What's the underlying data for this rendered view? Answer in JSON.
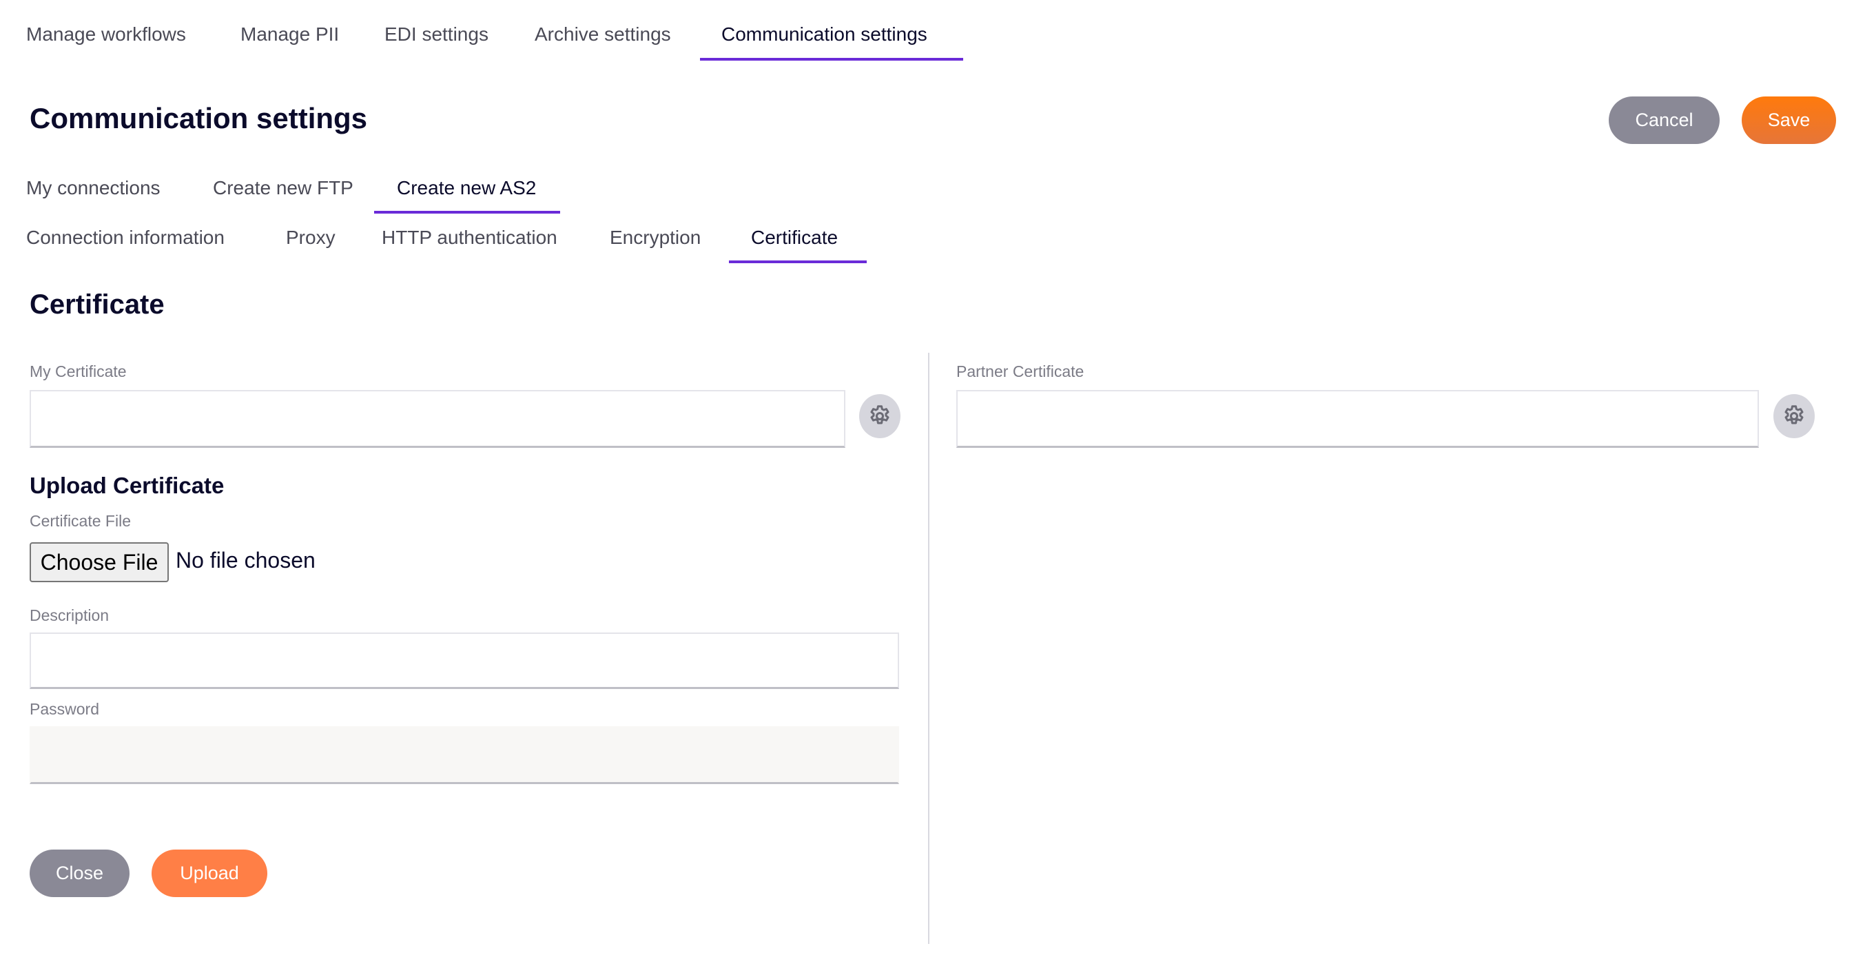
{
  "top_tabs": [
    {
      "label": "Manage workflows",
      "active": false
    },
    {
      "label": "Manage PII",
      "active": false
    },
    {
      "label": "EDI settings",
      "active": false
    },
    {
      "label": "Archive settings",
      "active": false
    },
    {
      "label": "Communication settings",
      "active": true
    }
  ],
  "page": {
    "title": "Communication settings",
    "cancel_label": "Cancel",
    "save_label": "Save"
  },
  "connection_tabs": [
    {
      "label": "My connections",
      "active": false
    },
    {
      "label": "Create new FTP",
      "active": false
    },
    {
      "label": "Create new AS2",
      "active": true
    }
  ],
  "as2_tabs": [
    {
      "label": "Connection information",
      "active": false
    },
    {
      "label": "Proxy",
      "active": false
    },
    {
      "label": "HTTP authentication",
      "active": false
    },
    {
      "label": "Encryption",
      "active": false
    },
    {
      "label": "Certificate",
      "active": true
    }
  ],
  "certificate": {
    "heading": "Certificate",
    "my_certificate": {
      "label": "My Certificate",
      "value": "",
      "settings_icon": "gear-icon"
    },
    "partner_certificate": {
      "label": "Partner Certificate",
      "value": "",
      "settings_icon": "gear-icon"
    },
    "upload": {
      "heading": "Upload Certificate",
      "file_label": "Certificate File",
      "choose_file_label": "Choose File",
      "file_status": "No file chosen",
      "description_label": "Description",
      "description_value": "",
      "password_label": "Password",
      "password_value": "",
      "close_label": "Close",
      "upload_label": "Upload"
    }
  },
  "colors": {
    "accent": "#6a2bd8",
    "primary_button": "#ff7a0c",
    "secondary_button": "#8a8996",
    "upload_button": "#ff7f46"
  }
}
